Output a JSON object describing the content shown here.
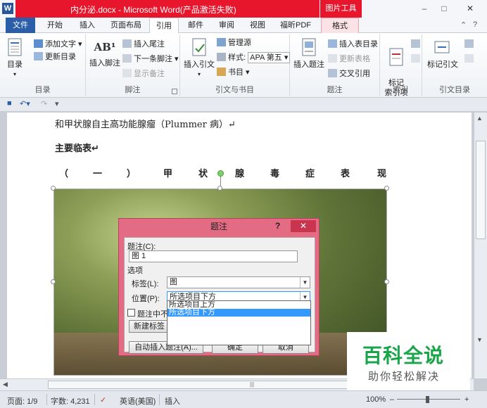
{
  "app": {
    "title": "内分泌.docx - Microsoft Word(产品激活失败)",
    "picture_tools": "图片工具",
    "logo": "W"
  },
  "window_controls": {
    "minimize": "–",
    "maximize": "□",
    "close": "✕"
  },
  "tabs": [
    "文件",
    "开始",
    "插入",
    "页面布局",
    "引用",
    "邮件",
    "审阅",
    "视图",
    "福昕PDF",
    "格式"
  ],
  "ribbon": {
    "toc_group": {
      "name": "目录",
      "big": "目录",
      "add_text": "添加文字",
      "update_toc": "更新目录"
    },
    "footnote_group": {
      "name": "脚注",
      "big_label": "插入脚注",
      "big_icon_text": "AB¹",
      "insert_endnote": "插入尾注",
      "next_footnote": "下一条脚注",
      "show_notes": "显示备注"
    },
    "citation_group": {
      "name": "引文与书目",
      "insert_citation": "插入引文",
      "manage_sources": "管理源",
      "style_label": "样式:",
      "style_value": "APA 第五",
      "bibliography": "书目"
    },
    "caption_group": {
      "name": "题注",
      "insert_caption": "插入题注",
      "insert_table_of_figures": "插入表目录",
      "update_table": "更新表格",
      "cross_reference": "交叉引用"
    },
    "index_group": {
      "name": "索引",
      "mark_entry": "标记\n索引项"
    },
    "toa_group": {
      "name": "引文目录",
      "mark_citation": "标记引文"
    }
  },
  "document": {
    "line1": "和甲状腺自主高功能腺瘤（Plummer 病）↵",
    "heading": "主要临表↵",
    "spread_chars": [
      "（",
      "一",
      "）",
      "甲",
      "状",
      "腺",
      "毒",
      "症",
      "表",
      "现"
    ]
  },
  "dialog": {
    "title": "题注",
    "help": "?",
    "close": "✕",
    "caption_label": "题注(C):",
    "caption_value": "图 1",
    "options_label": "选项",
    "label_label": "标签(L):",
    "label_value": "图",
    "position_label": "位置(P):",
    "position_value": "所选项目下方",
    "exclude_label": "题注中不包",
    "new_label_button": "新建标签",
    "autocaption_button": "自动插入题注(A)...",
    "ok_button": "确定",
    "cancel_button": "取消",
    "position_options": [
      "所选项目上方",
      "所选项目下方"
    ],
    "selected_option": 1
  },
  "status": {
    "page": "页面: 1/9",
    "words": "字数: 4,231",
    "language": "英语(美国)",
    "mode": "插入",
    "zoom": "100%",
    "zoom_minus": "–",
    "zoom_plus": "+"
  },
  "watermark": {
    "line1": "百科全说",
    "line2": "助你轻松解决"
  },
  "colors": {
    "title_red": "#e8162c",
    "file_blue": "#2a5ea8",
    "dialog_pink": "#e36b84",
    "watermark_green": "#1ba54a",
    "selection_blue": "#3399ff"
  }
}
